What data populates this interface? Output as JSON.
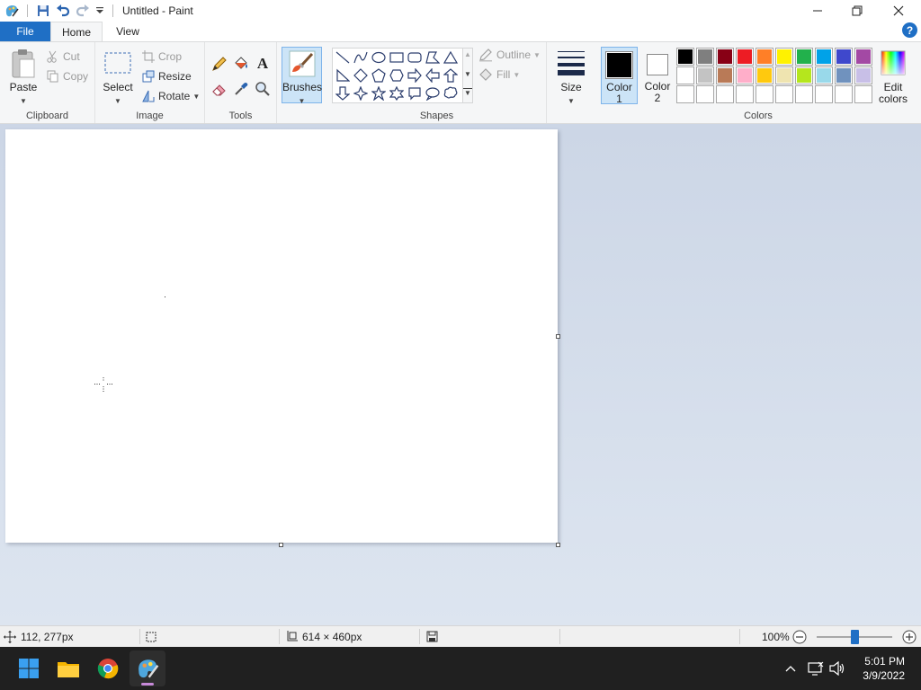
{
  "window": {
    "title": "Untitled - Paint",
    "controls": {
      "minimize": "—",
      "maximize": "❐",
      "close": "✕"
    }
  },
  "ribbon_tabs": [
    {
      "label": "File"
    },
    {
      "label": "Home"
    },
    {
      "label": "View"
    }
  ],
  "help": "?",
  "clipboard": {
    "paste": "Paste",
    "cut": "Cut",
    "copy": "Copy",
    "group_label": "Clipboard"
  },
  "image": {
    "select": "Select",
    "crop": "Crop",
    "resize": "Resize",
    "rotate": "Rotate",
    "group_label": "Image"
  },
  "tools": {
    "group_label": "Tools",
    "text_glyph": "A"
  },
  "brushes": {
    "label": "Brushes"
  },
  "shapes": {
    "outline": "Outline",
    "fill": "Fill",
    "group_label": "Shapes"
  },
  "size": {
    "label": "Size"
  },
  "colors": {
    "color1_label": "Color",
    "color1_num": "1",
    "color2_label": "Color",
    "color2_num": "2",
    "edit_label": "Edit",
    "edit_label2": "colors",
    "group_label": "Colors",
    "color1": "#000000",
    "color2": "#ffffff",
    "palette_row1": [
      "#000000",
      "#7f7f7f",
      "#880015",
      "#ed1c24",
      "#ff7f27",
      "#fff200",
      "#22b14c",
      "#00a2e8",
      "#3f48cc",
      "#a349a4"
    ],
    "palette_row2": [
      "#ffffff",
      "#c3c3c3",
      "#b97a57",
      "#ffaec9",
      "#ffc90e",
      "#efe4b0",
      "#b5e61d",
      "#99d9ea",
      "#7092be",
      "#c8bfe7"
    ],
    "palette_row3": [
      "#ffffff",
      "#ffffff",
      "#ffffff",
      "#ffffff",
      "#ffffff",
      "#ffffff",
      "#ffffff",
      "#ffffff",
      "#ffffff",
      "#ffffff"
    ]
  },
  "status": {
    "cursor_pos": "112, 277px",
    "canvas_size": "614 × 460px",
    "zoom": "100%",
    "zoom_level": 0.5
  },
  "taskbar": {
    "time": "5:01 PM",
    "date": "3/9/2022"
  }
}
